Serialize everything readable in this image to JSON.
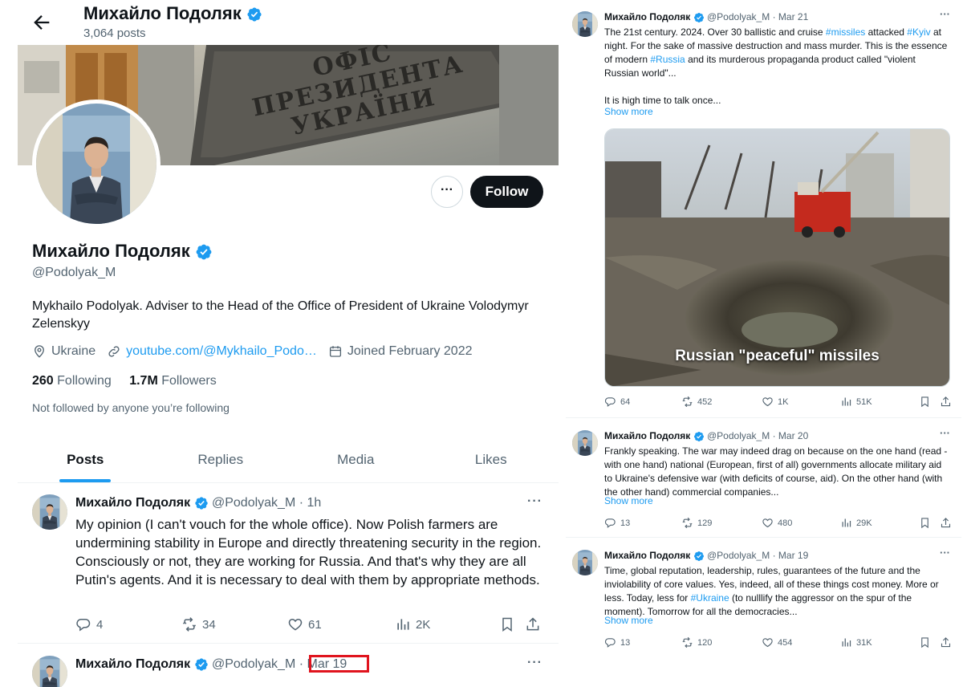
{
  "profile": {
    "name": "Михайло Подоляк",
    "header_name": "Михайло Подоляк",
    "posts_count": "3,064 posts",
    "handle": "@Podolyak_M",
    "bio": "Mykhailo Podolyak. Adviser to the Head of the Office of President of Ukraine Volodymyr Zelenskyy",
    "location": "Ukraine",
    "link": "youtube.com/@Mykhailo_Podo…",
    "joined": "Joined February 2022",
    "following_count": "260",
    "following_label": "Following",
    "followers_count": "1.7M",
    "followers_label": "Followers",
    "not_followed": "Not followed by anyone you’re following",
    "follow_label": "Follow",
    "more_label": "···",
    "banner_sign": [
      "ОФІС",
      "ПРЕЗИДЕНТА",
      "УКРАЇНИ"
    ]
  },
  "tabs": [
    {
      "label": "Posts",
      "active": true
    },
    {
      "label": "Replies",
      "active": false
    },
    {
      "label": "Media",
      "active": false
    },
    {
      "label": "Likes",
      "active": false
    }
  ],
  "left_tweets": [
    {
      "name": "Михайло Подоляк",
      "handle": "@Podolyak_M",
      "time": "1h",
      "text": "My opinion (I can't vouch for the whole office). Now Polish farmers are undermining stability in Europe and directly threatening security in the region. Consciously or not, they are working for Russia. And that's why they are all Putin's agents. And it is necessary to deal with them by appropriate methods.",
      "replies": "4",
      "reposts": "34",
      "likes": "61",
      "views": "2K"
    },
    {
      "name": "Михайло Подоляк",
      "handle": "@Podolyak_M",
      "time": "Mar 19"
    }
  ],
  "right_tweets": [
    {
      "name": "Михайло Подоляк",
      "handle": "@Podolyak_M",
      "time": "Mar 21",
      "text_parts": [
        {
          "t": "The 21st century. 2024. Over 30 ballistic and cruise "
        },
        {
          "t": "#missiles",
          "tag": true
        },
        {
          "t": " attacked "
        },
        {
          "t": "#Kyiv",
          "tag": true
        },
        {
          "t": " at night. For the sake of massive destruction and mass murder. This is the essence of modern "
        },
        {
          "t": "#Russia",
          "tag": true
        },
        {
          "t": " and its murderous propaganda product called \"violent Russian world\"..."
        }
      ],
      "text_tail": "It is high time to talk once...",
      "show_more": "Show more",
      "media_caption": "Russian \"peaceful\" missiles",
      "replies": "64",
      "reposts": "452",
      "likes": "1K",
      "views": "51K"
    },
    {
      "name": "Михайло Подоляк",
      "handle": "@Podolyak_M",
      "time": "Mar 20",
      "text": "Frankly speaking. The war may indeed drag on because on the one hand (read - with one hand) national (European, first of all) governments allocate military aid to Ukraine's defensive war (with deficits of course, aid). On the other hand (with the other hand) commercial companies...",
      "show_more": "Show more",
      "replies": "13",
      "reposts": "129",
      "likes": "480",
      "views": "29K"
    },
    {
      "name": "Михайло Подоляк",
      "handle": "@Podolyak_M",
      "time": "Mar 19",
      "text_parts": [
        {
          "t": "Time, global reputation, leadership, rules, guarantees of the future and the inviolability of core values. Yes, indeed, all of these things cost money. More or less. Today, less for "
        },
        {
          "t": "#Ukraine",
          "tag": true
        },
        {
          "t": " (to nulllify the aggressor on the spur of the moment). Tomorrow for all the democracies..."
        }
      ],
      "show_more": "Show more",
      "replies": "13",
      "reposts": "120",
      "likes": "454",
      "views": "31K"
    }
  ],
  "colors": {
    "accent": "#1d9bf0",
    "text": "#0f1419",
    "muted": "#536471",
    "highlight": "#e0141e"
  }
}
